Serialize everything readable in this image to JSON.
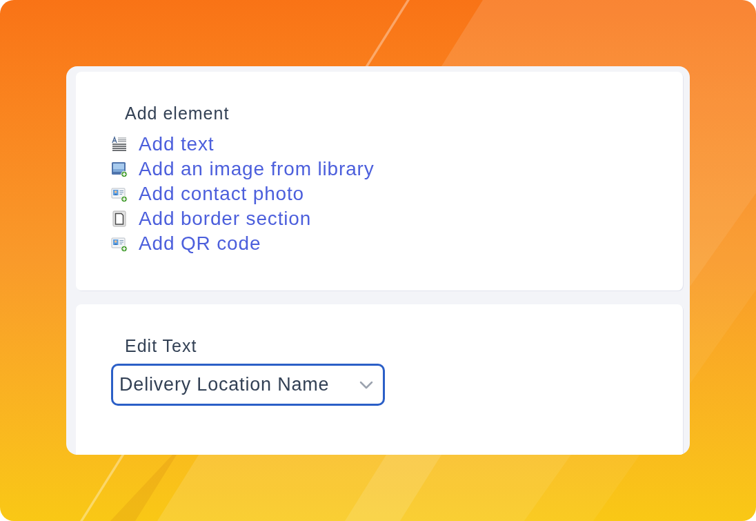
{
  "add_element": {
    "title": "Add element",
    "items": [
      {
        "kind": "text",
        "label": "Add text"
      },
      {
        "kind": "image",
        "label": "Add an image from library"
      },
      {
        "kind": "contact",
        "label": "Add contact photo"
      },
      {
        "kind": "border",
        "label": "Add border section"
      },
      {
        "kind": "contact",
        "label": "Add QR code"
      }
    ]
  },
  "edit_text": {
    "title": "Edit Text",
    "select": {
      "value": "Delivery Location Name",
      "focused": true
    }
  }
}
